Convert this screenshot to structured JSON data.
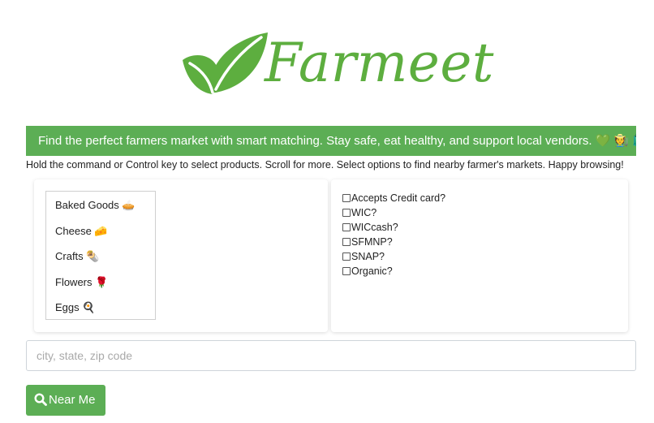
{
  "header": {
    "logo_text": "Farmeet",
    "logo_icon": "leaf-icon",
    "brand_color": "#5dae3f"
  },
  "banner": {
    "text": "Find the perfect farmers market with smart matching. Stay safe, eat healthy, and support local vendors. 💚 🧑‍🌾 🛍️",
    "background": "#5cae55"
  },
  "instructions": "Hold the command or Control key to select products. Scroll for more. Select options to find nearby farmer's markets. Happy browsing!",
  "products": {
    "items": [
      {
        "label": "Baked Goods 🥧"
      },
      {
        "label": "Cheese 🧀"
      },
      {
        "label": "Crafts 🌯"
      },
      {
        "label": "Flowers 🌹"
      },
      {
        "label": "Eggs 🍳"
      }
    ]
  },
  "options": {
    "items": [
      {
        "label": "Accepts Credit card?",
        "checked": false
      },
      {
        "label": "WIC?",
        "checked": false
      },
      {
        "label": "WICcash?",
        "checked": false
      },
      {
        "label": "SFMNP?",
        "checked": false
      },
      {
        "label": "SNAP?",
        "checked": false
      },
      {
        "label": "Organic?",
        "checked": false
      }
    ]
  },
  "search": {
    "placeholder": "city, state, zip code",
    "value": ""
  },
  "near_me": {
    "label": "Near Me",
    "icon": "search-icon"
  }
}
